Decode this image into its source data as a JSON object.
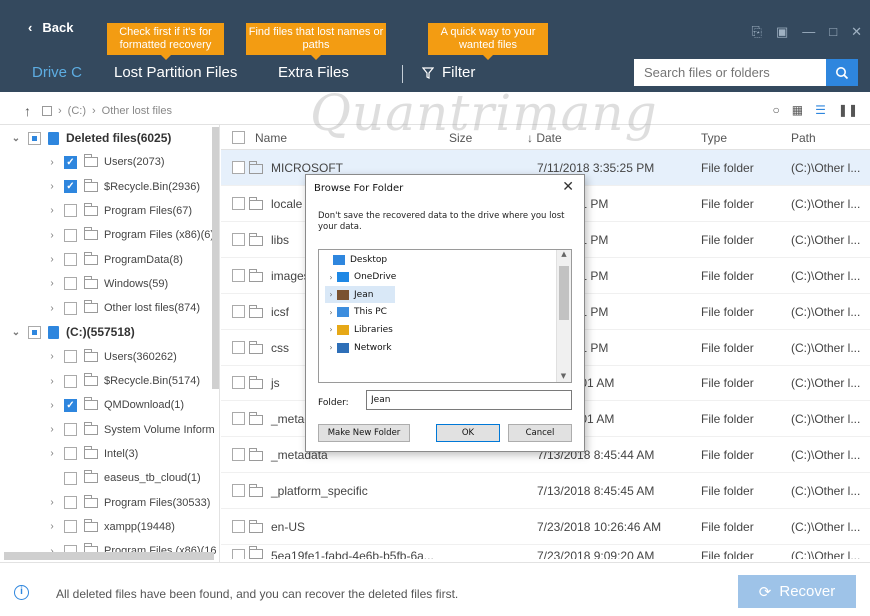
{
  "header": {
    "back_label": "Back",
    "tips": [
      "Check first if it's for formatted recovery",
      "Find files that lost names or paths",
      "A quick way to your wanted files"
    ],
    "tabs": {
      "drive": "Drive C",
      "lost_partition": "Lost Partition Files",
      "extra": "Extra Files",
      "filter": "Filter"
    },
    "search_placeholder": "Search files or folders",
    "accent_color": "#2e86de",
    "bg_color": "#34495e",
    "tip_color": "#f39c12"
  },
  "pathbar": {
    "drive": "(C:)",
    "folder": "Other lost files"
  },
  "tree": [
    {
      "label": "Deleted files(6025)",
      "level": 0,
      "bold": true,
      "check": "partial",
      "icon": "recycle-bin-icon"
    },
    {
      "label": "Users(2073)",
      "level": 1,
      "check": "checked"
    },
    {
      "label": "$Recycle.Bin(2936)",
      "level": 1,
      "check": "checked"
    },
    {
      "label": "Program Files(67)",
      "level": 1,
      "check": "none"
    },
    {
      "label": "Program Files (x86)(6)",
      "level": 1,
      "check": "none"
    },
    {
      "label": "ProgramData(8)",
      "level": 1,
      "check": "none"
    },
    {
      "label": "Windows(59)",
      "level": 1,
      "check": "none"
    },
    {
      "label": "Other lost files(874)",
      "level": 1,
      "check": "none"
    },
    {
      "label": "(C:)(557518)",
      "level": 0,
      "bold": true,
      "check": "partial",
      "icon": "drive-icon"
    },
    {
      "label": "Users(360262)",
      "level": 1,
      "check": "none"
    },
    {
      "label": "$Recycle.Bin(5174)",
      "level": 1,
      "check": "none"
    },
    {
      "label": "QMDownload(1)",
      "level": 1,
      "check": "checked"
    },
    {
      "label": "System Volume Inform",
      "level": 1,
      "check": "none"
    },
    {
      "label": "Intel(3)",
      "level": 1,
      "check": "none"
    },
    {
      "label": "easeus_tb_cloud(1)",
      "level": 1,
      "check": "none",
      "no_arrow": true
    },
    {
      "label": "Program Files(30533)",
      "level": 1,
      "check": "none"
    },
    {
      "label": "xampp(19448)",
      "level": 1,
      "check": "none"
    },
    {
      "label": "Program Files (x86)(16",
      "level": 1,
      "check": "none"
    }
  ],
  "table": {
    "headers": {
      "name": "Name",
      "size": "Size",
      "date": "Date",
      "type": "Type",
      "path": "Path"
    },
    "rows": [
      {
        "name": "MICROSOFT",
        "date": "7/11/2018 3:35:25 PM",
        "type": "File folder",
        "path": "(C:)\\Other l...",
        "selected": true
      },
      {
        "name": "locale",
        "date": "8 3:40:51 PM",
        "type": "File folder",
        "path": "(C:)\\Other l..."
      },
      {
        "name": "libs",
        "date": "8 3:40:51 PM",
        "type": "File folder",
        "path": "(C:)\\Other l..."
      },
      {
        "name": "images",
        "date": "8 3:40:51 PM",
        "type": "File folder",
        "path": "(C:)\\Other l..."
      },
      {
        "name": "icsf",
        "date": "8 3:40:51 PM",
        "type": "File folder",
        "path": "(C:)\\Other l..."
      },
      {
        "name": "css",
        "date": "8 3:40:51 PM",
        "type": "File folder",
        "path": "(C:)\\Other l..."
      },
      {
        "name": "js",
        "date": "8 10:27:01 AM",
        "type": "File folder",
        "path": "(C:)\\Other l..."
      },
      {
        "name": "_metad",
        "date": "8 10:27:01 AM",
        "type": "File folder",
        "path": "(C:)\\Other l..."
      },
      {
        "name": "_metadata",
        "date": "7/13/2018 8:45:44 AM",
        "type": "File folder",
        "path": "(C:)\\Other l..."
      },
      {
        "name": "_platform_specific",
        "date": "7/13/2018 8:45:45 AM",
        "type": "File folder",
        "path": "(C:)\\Other l..."
      },
      {
        "name": "en-US",
        "date": "7/23/2018 10:26:46 AM",
        "type": "File folder",
        "path": "(C:)\\Other l..."
      },
      {
        "name": "5ea19fe1-fabd-4e6b-b5fb-6a...",
        "date": "7/23/2018 9:09:20 AM",
        "type": "File folder",
        "path": "(C:)\\Other l..."
      }
    ]
  },
  "watermark": "Quantrimang",
  "dialog": {
    "title": "Browse For Folder",
    "message": "Don't save the recovered data to the drive where you lost your data.",
    "items": [
      {
        "label": "Desktop",
        "level": 0,
        "icon": "desktop-icon",
        "arrow": false
      },
      {
        "label": "OneDrive",
        "level": 1,
        "icon": "onedrive-icon",
        "arrow": true
      },
      {
        "label": "Jean",
        "level": 1,
        "icon": "user-icon",
        "arrow": true,
        "selected": true
      },
      {
        "label": "This PC",
        "level": 1,
        "icon": "pc-icon",
        "arrow": true
      },
      {
        "label": "Libraries",
        "level": 1,
        "icon": "libraries-icon",
        "arrow": true
      },
      {
        "label": "Network",
        "level": 1,
        "icon": "network-icon",
        "arrow": true
      }
    ],
    "folder_label": "Folder:",
    "folder_value": "Jean",
    "btn_new": "Make New Folder",
    "btn_ok": "OK",
    "btn_cancel": "Cancel"
  },
  "footer": {
    "message": "All deleted files have been found, and you can recover the deleted files first.",
    "recover_label": "Recover"
  }
}
